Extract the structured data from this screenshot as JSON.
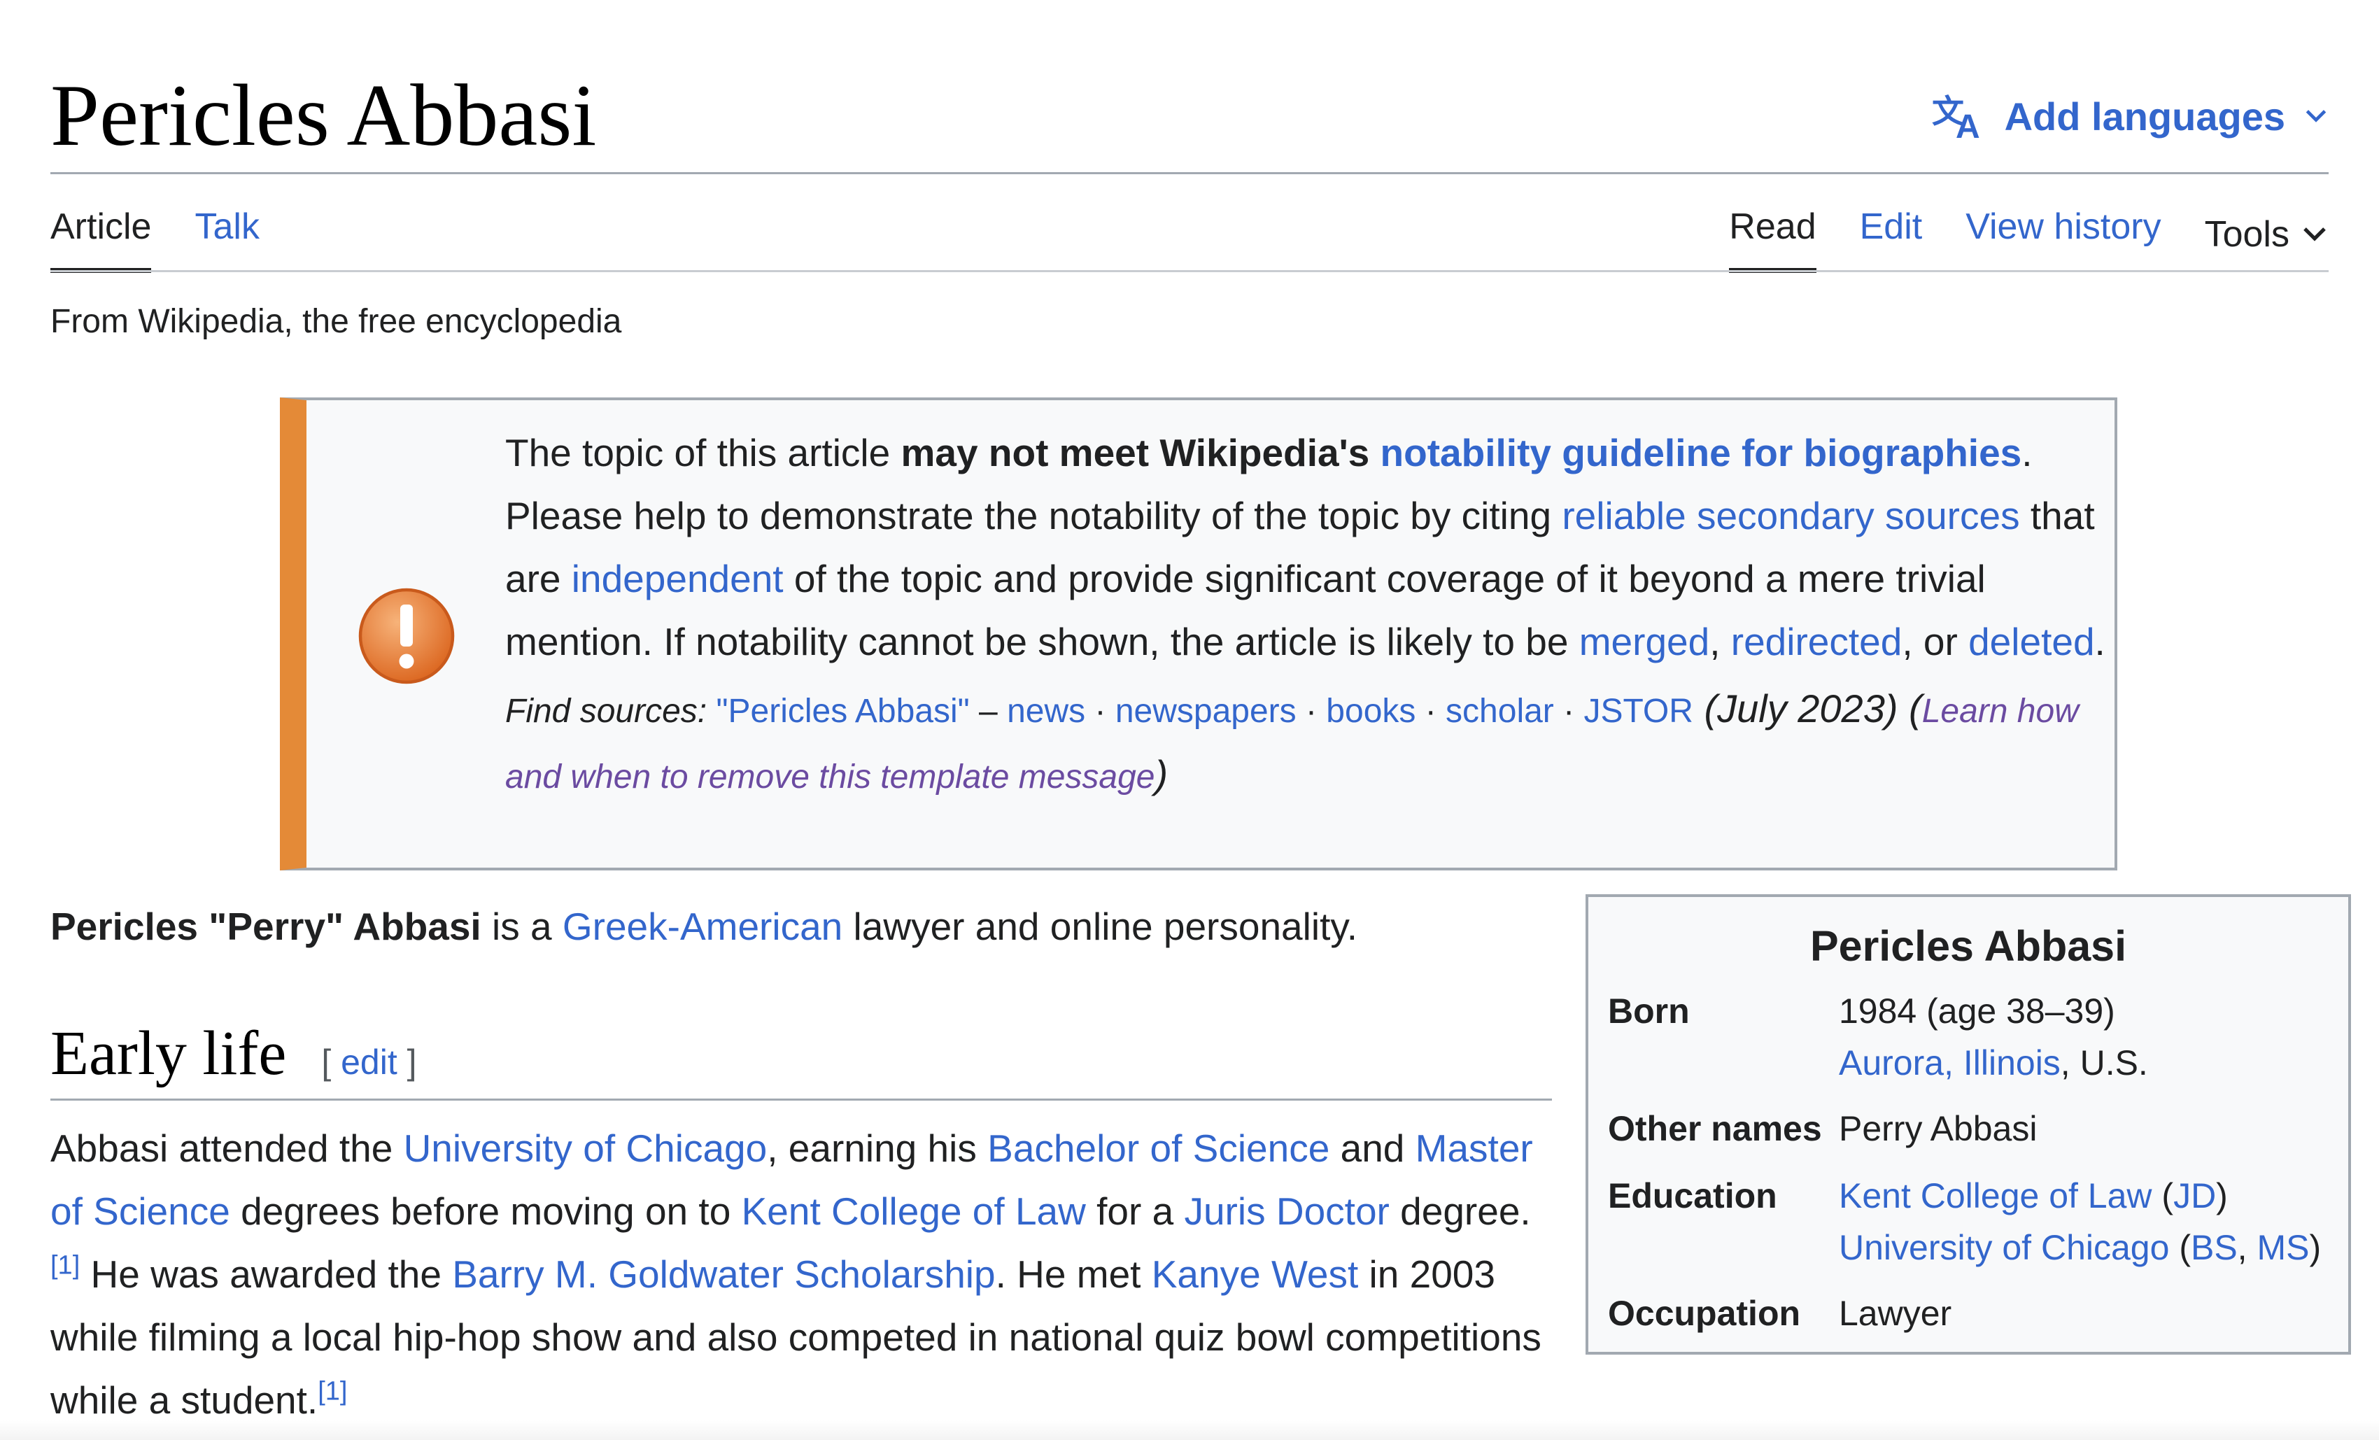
{
  "header": {
    "title": "Pericles Abbasi",
    "add_languages": "Add languages"
  },
  "tabs_left": [
    "Article",
    "Talk"
  ],
  "tabs_right": [
    "Read",
    "Edit",
    "View history",
    "Tools"
  ],
  "tagline": "From Wikipedia, the free encyclopedia",
  "notice": {
    "p1": "The topic of this article ",
    "bold": "may not meet Wikipedia's ",
    "guideline_link": "notability guideline for biographies",
    "p2": ". Please help to demonstrate the notability of the topic by citing ",
    "sources_link": "reliable secondary sources",
    "p3": " that are ",
    "independent_link": "independent",
    "p4": " of the topic and provide significant coverage of it beyond a mere trivial mention. If notability cannot be shown, the article is likely to be ",
    "merged_link": "merged",
    "comma": ", ",
    "redirected_link": "redirected",
    "or": ", or ",
    "deleted_link": "deleted",
    "period": ".",
    "find_sources_label": "Find sources:",
    "fs_query": "\"Pericles Abbasi\"",
    "fs_dash": " – ",
    "fs_news": "news",
    "fs_newspapers": "newspapers",
    "fs_books": "books",
    "fs_scholar": "scholar",
    "fs_jstor": "JSTOR",
    "fs_sep": " · ",
    "date": " (July 2023) ",
    "learn_open": "(",
    "learn_link": "Learn how and when to remove this template message",
    "learn_close": ")"
  },
  "lead": {
    "bold": "Pericles \"Perry\" Abbasi",
    "t1": " is a ",
    "link": "Greek-American",
    "t2": " lawyer and online personality."
  },
  "section": {
    "heading": "Early life",
    "edit_open": "[ ",
    "edit": "edit",
    "edit_close": " ]"
  },
  "early_life": {
    "t1": "Abbasi attended the ",
    "l1": "University of Chicago",
    "t2": ", earning his ",
    "l2": "Bachelor of Science",
    "t3": " and ",
    "l3": "Master of Science",
    "t4": " degrees before moving on to ",
    "l4": "Kent College of Law",
    "t5": " for a ",
    "l5": "Juris Doctor",
    "t6": " degree.",
    "ref": "[1]",
    "t7": " He was awarded the ",
    "l6": "Barry M. Goldwater Scholarship",
    "t8": ". He met ",
    "l7": "Kanye West",
    "t9": " in 2003 while filming a local hip-hop show and also competed in national quiz bowl competitions while a student."
  },
  "infobox": {
    "title": "Pericles Abbasi",
    "born_label": "Born",
    "born_value": "1984 (age 38–39)",
    "born_place_link": "Aurora, Illinois",
    "born_place_rest": ", U.S.",
    "other_label": "Other names",
    "other_value": "Perry Abbasi",
    "education_label": "Education",
    "edu1_link": "Kent College of Law",
    "edu1_open": " (",
    "edu1_deg": "JD",
    "edu1_close": ")",
    "edu2_link": "University of Chicago",
    "edu2_open": " (",
    "edu2_deg1": "BS",
    "edu2_comma": ", ",
    "edu2_deg2": "MS",
    "edu2_close": ")",
    "occupation_label": "Occupation",
    "occupation_value": "Lawyer"
  },
  "colors": {
    "link": "#3366cc",
    "visited_link": "#6b4ba1",
    "notice_stripe": "#e48a37",
    "border": "#a2a9b1"
  },
  "icons": [
    "translate-icon",
    "chevron-down-icon",
    "warning-icon"
  ]
}
